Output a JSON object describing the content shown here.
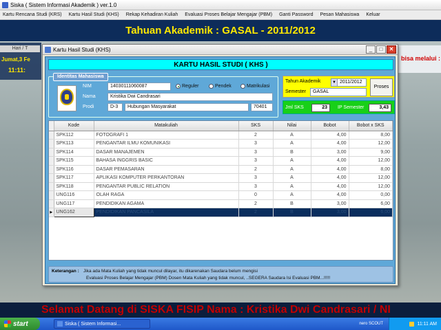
{
  "app": {
    "title": "Siska  ( Sistem Informasi Akademik )  ver.1.0",
    "menu": [
      "Kartu Rencana Studi (KRS)",
      "Kartu Hasil Studi (KHS)",
      "Rekap Kehadiran Kuliah",
      "Evaluasi Proses Belajar Mengajar (PBM)",
      "Ganti Password",
      "Pesan Mahasiswa",
      "Keluar"
    ],
    "banner": "Tahuan Akademik : GASAL - 2011/2012",
    "footer_banner": "Selamat Datang di SISKA FISIP Nama : Kristika Dwi Candrasari / NI",
    "bg_hari": "Hari / T",
    "bg_jumat": "Jumat,3 Fe",
    "bg_time": "11:11:",
    "bg_right": "bisa melalui :"
  },
  "taskbar": {
    "start": "start",
    "task": "Siska  ( Sistem Informasi...",
    "nero": "nero SCOUT",
    "clock": "11:11 AM"
  },
  "dialog": {
    "title": "Kartu Hasil Studi  (KHS)",
    "header": "KARTU HASIL STUDI ( KHS )",
    "identitas_legend": "Identitas Mahasiswa",
    "labels": {
      "nim": "NIM",
      "nama": "Nama",
      "prodi": "Prodi"
    },
    "nim": "14030111060087",
    "nama": "Kristika Dwi Candrasari",
    "prodi_jenjang": "D-3",
    "prodi_nama": "Hubungan Masyarakat",
    "prodi_kode": "70401",
    "radios": [
      {
        "label": "Reguler",
        "selected": true
      },
      {
        "label": "Pendek",
        "selected": false
      },
      {
        "label": "Matrikulasi",
        "selected": false
      }
    ],
    "tahun_label": "Tahun Akademik",
    "tahun_value": "2011/2012",
    "semester_label": "Semester",
    "semester_value": "GASAL",
    "proses_label": "Proses",
    "jml_sks_label": "Jml SKS",
    "jml_sks_value": "23",
    "ip_label": "IP Semester",
    "ip_value": "3,43",
    "ket_label": "Keterangan :",
    "ket_line1": "Jika ada Mata Kuliah yang tidak muncul dilayar, itu dikarenakan Saudara belum mengisi",
    "ket_line2": "Evaluasi  Proses Belajar Mengajar (PBM) Dosen Mata Kuliah yang tidak muncul,    ..SEGERA Saudara Isi Evaluasi PBM...!!!!!"
  },
  "table": {
    "columns": [
      "Kode",
      "Matakuliah",
      "SKS",
      "Nilai",
      "Bobot",
      "Bobot x SKS"
    ],
    "rows": [
      [
        "SPK112",
        "FOTOGRAFI 1",
        "2",
        "A",
        "4,00",
        "8,00"
      ],
      [
        "SPK113",
        "PENGANTAR ILMU KOMUNIKASI",
        "3",
        "A",
        "4,00",
        "12,00"
      ],
      [
        "SPK114",
        "DASAR MANAJEMEN",
        "3",
        "B",
        "3,00",
        "9,00"
      ],
      [
        "SPK115",
        "BAHASA INGGRIS BASIC",
        "3",
        "A",
        "4,00",
        "12,00"
      ],
      [
        "SPK116",
        "DASAR PEMASARAN",
        "2",
        "A",
        "4,00",
        "8,00"
      ],
      [
        "SPK117",
        "APLIKASI KOMPUTER PERKANTORAN",
        "3",
        "A",
        "4,00",
        "12,00"
      ],
      [
        "SPK118",
        "PENGANTAR PUBLIC RELATION",
        "3",
        "A",
        "4,00",
        "12,00"
      ],
      [
        "UNG116",
        "OLAH RAGA",
        "0",
        "A",
        "4,00",
        "0,00"
      ],
      [
        "UNG117",
        "PENDIDIKAN AGAMA",
        "2",
        "B",
        "3,00",
        "6,00"
      ],
      [
        "UNG162",
        "PENDIDIKAN PANCASILA",
        "2",
        "B",
        "3,00",
        "6,00"
      ]
    ],
    "selected_row": 9
  }
}
